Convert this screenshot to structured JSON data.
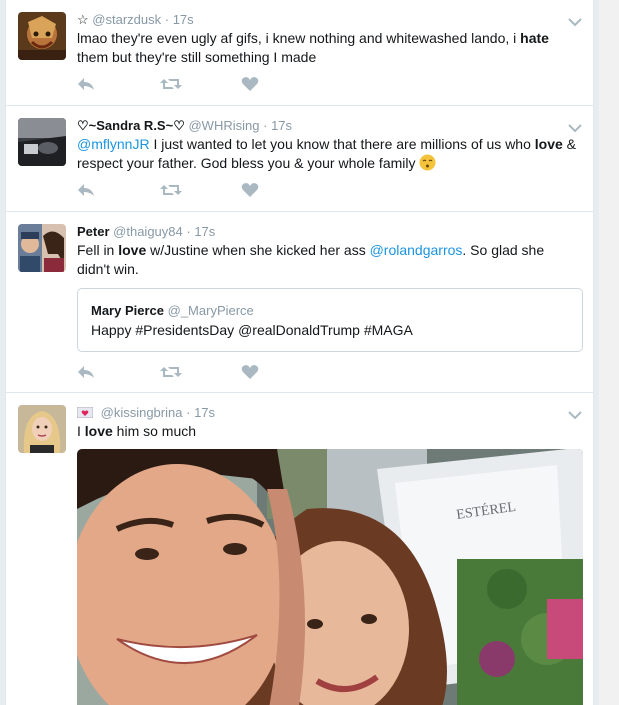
{
  "tweets": [
    {
      "icon_prefix": "☆",
      "fullname": "",
      "username": "@starzdusk",
      "time": "17s",
      "text_parts": [
        "lmao they're even ugly af gifs, i knew nothing and whitewashed lando, i ",
        "hate",
        " them but they're still something I made"
      ]
    },
    {
      "fullname": "♡~Sandra R.S~♡",
      "username": "@WHRising",
      "time": "17s",
      "text_parts": [
        "@mflynnJR",
        " I just wanted to let you know that there are millions of us who ",
        "love",
        " & respect your father. God bless you & your whole family "
      ]
    },
    {
      "fullname": "Peter",
      "username": "@thaiguy84",
      "time": "17s",
      "text_parts": [
        "Fell in ",
        "love",
        " w/Justine when she kicked her ass ",
        "@rolandgarros",
        ". So glad she didn't win."
      ],
      "quote": {
        "fullname": "Mary Pierce",
        "username": "@_MaryPierce",
        "text": "Happy #PresidentsDay @realDonaldTrump #MAGA"
      }
    },
    {
      "fullname": "",
      "username": "@kissingbrina",
      "time": "17s",
      "text_parts": [
        "I ",
        "love",
        " him so much"
      ],
      "photo_sign": "ESTÉREL"
    }
  ],
  "separator": "·",
  "icons": {
    "reply": "reply-icon",
    "retweet": "retweet-icon",
    "like": "heart-icon",
    "caret": "chevron-down-icon"
  },
  "colors": {
    "link": "#1b95e0",
    "muted": "#8899a6",
    "icon": "#aab8c2"
  }
}
